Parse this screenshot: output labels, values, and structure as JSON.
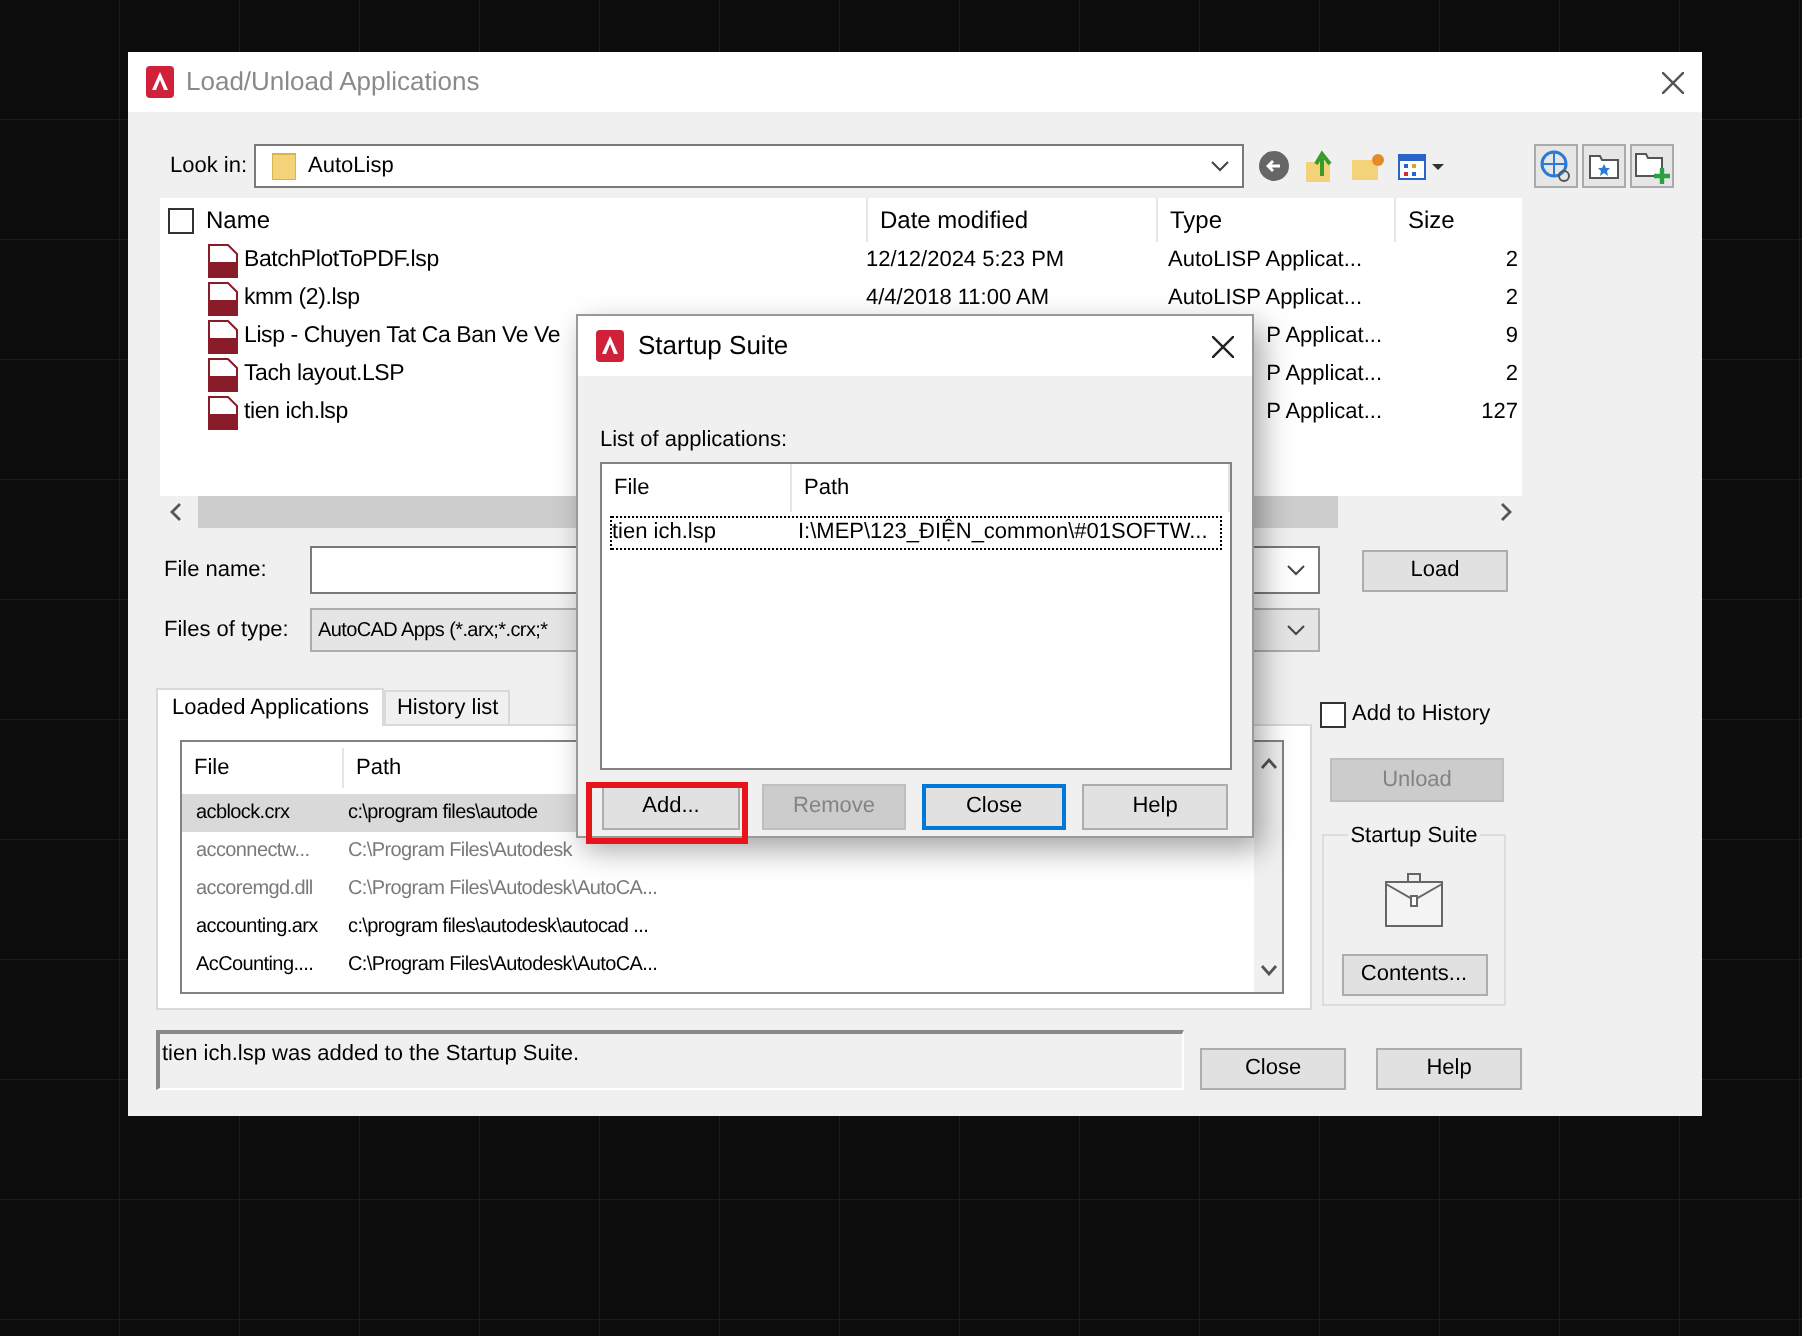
{
  "main_window": {
    "title": "Load/Unload Applications",
    "look_in": {
      "label": "Look in:",
      "value": "AutoLisp"
    },
    "file_list": {
      "select_all": {
        "checked": false
      },
      "columns": [
        "Name",
        "Date modified",
        "Type",
        "Size"
      ],
      "rows": [
        {
          "name": "BatchPlotToPDF.lsp",
          "date": "12/12/2024 5:23 PM",
          "type": "AutoLISP Applicat...",
          "size": "2"
        },
        {
          "name": "kmm (2).lsp",
          "date": "4/4/2018 11:00 AM",
          "type": "AutoLISP Applicat...",
          "size": "2"
        },
        {
          "name": "Lisp - Chuyen Tat Ca Ban Ve Ve",
          "type": "P Applicat...",
          "size": "9"
        },
        {
          "name": "Tach layout.LSP",
          "type": "P Applicat...",
          "size": "2"
        },
        {
          "name": "tien ich.lsp",
          "type": "P Applicat...",
          "size": "127"
        }
      ]
    },
    "file_name": {
      "label": "File name:"
    },
    "files_of_type": {
      "label": "Files of type:",
      "value": "AutoCAD Apps (*.arx;*.crx;*"
    },
    "load_button": "Load",
    "tabs": [
      {
        "label": "Loaded Applications",
        "selected": true
      },
      {
        "label": "History list",
        "selected": false
      }
    ],
    "loaded_list": {
      "columns": [
        "File",
        "Path"
      ],
      "rows": [
        {
          "file": "acblock.crx",
          "path": "c:\\program files\\autode",
          "disabled": false,
          "selected": true
        },
        {
          "file": "acconnectw...",
          "path": "C:\\Program Files\\Autodesk",
          "disabled": true,
          "selected": false
        },
        {
          "file": "accoremgd.dll",
          "path": "C:\\Program Files\\Autodesk\\AutoCA...",
          "disabled": true,
          "selected": false
        },
        {
          "file": "accounting.arx",
          "path": "c:\\program files\\autodesk\\autocad ...",
          "disabled": false,
          "selected": false
        },
        {
          "file": "AcCounting....",
          "path": "C:\\Program Files\\Autodesk\\AutoCA...",
          "disabled": false,
          "selected": false
        }
      ]
    },
    "add_to_history": {
      "label": "Add to History",
      "checked": false
    },
    "unload_button": {
      "label": "Unload",
      "disabled": true
    },
    "startup_suite": {
      "label": "Startup Suite",
      "button": "Contents..."
    },
    "status": "tien ich.lsp was added to the Startup Suite.",
    "buttons": [
      "Close",
      "Help"
    ]
  },
  "dialog": {
    "title": "Startup Suite",
    "list_label": "List of applications:",
    "columns": [
      "File",
      "Path"
    ],
    "rows": [
      {
        "file": "tien ich.lsp",
        "path": "I:\\MEP\\123_ĐIỆN_common\\#01SOFTW...",
        "focused": true
      }
    ],
    "buttons": [
      {
        "label": "Add...",
        "disabled": false,
        "default": false,
        "highlighted": true
      },
      {
        "label": "Remove",
        "disabled": true,
        "default": false,
        "highlighted": false
      },
      {
        "label": "Close",
        "disabled": false,
        "default": true,
        "highlighted": false
      },
      {
        "label": "Help",
        "disabled": false,
        "default": false,
        "highlighted": false
      }
    ]
  }
}
